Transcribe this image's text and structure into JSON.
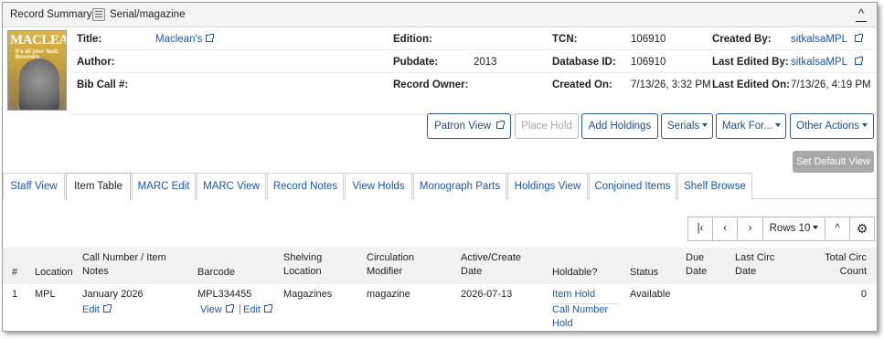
{
  "summary": {
    "title": "Record Summary",
    "format": "Serial/magazine",
    "cover_masthead": "MACLEAN'S",
    "cover_tagline": "It's all your fault, Boomers",
    "fields": {
      "title_label": "Title:",
      "title_value": "Maclean's",
      "author_label": "Author:",
      "author_value": "",
      "bibcall_label": "Bib Call #:",
      "bibcall_value": "",
      "edition_label": "Edition:",
      "edition_value": "",
      "pubdate_label": "Pubdate:",
      "pubdate_value": "2013",
      "owner_label": "Record Owner:",
      "owner_value": "",
      "tcn_label": "TCN:",
      "tcn_value": "106910",
      "dbid_label": "Database ID:",
      "dbid_value": "106910",
      "created_on_label": "Created On:",
      "created_on_value": "7/13/26, 3:32 PM",
      "created_by_label": "Created By:",
      "created_by_value": "sitkalsaMPL",
      "edited_by_label": "Last Edited By:",
      "edited_by_value": "sitkalsaMPL",
      "edited_on_label": "Last Edited On:",
      "edited_on_value": "7/13/26, 4:19 PM"
    }
  },
  "actions": {
    "patron_view": "Patron View",
    "place_hold": "Place Hold",
    "add_holdings": "Add Holdings",
    "serials": "Serials",
    "mark_for": "Mark For...",
    "other_actions": "Other Actions",
    "set_default_view": "Set Default View"
  },
  "tabs": [
    "Staff View",
    "Item Table",
    "MARC Edit",
    "MARC View",
    "Record Notes",
    "View Holds",
    "Monograph Parts",
    "Holdings View",
    "Conjoined Items",
    "Shelf Browse"
  ],
  "active_tab": "Item Table",
  "pager": {
    "first_icon": "first-page-icon",
    "prev_icon": "chevron-left-icon",
    "next_icon": "chevron-right-icon",
    "rows_label": "Rows 10",
    "collapse_icon": "chevron-up-icon",
    "settings_icon": "gear-icon"
  },
  "table": {
    "headers": {
      "num": "#",
      "location": "Location",
      "callnum": "Call Number / Item Notes",
      "barcode": "Barcode",
      "shelving": "Shelving Location",
      "circmod": "Circulation Modifier",
      "active": "Active/Create Date",
      "holdable": "Holdable?",
      "status": "Status",
      "due": "Due Date",
      "lastcirc": "Last Circ Date",
      "totalcirc": "Total Circ Count"
    },
    "rows": [
      {
        "num": "1",
        "location": "MPL",
        "callnum": "January 2026",
        "callnum_edit": "Edit",
        "barcode": "MPL334455",
        "barcode_view": "View",
        "barcode_edit": "Edit",
        "shelving": "Magazines",
        "circmod": "magazine",
        "active": "2026-07-13",
        "item_hold": "Item Hold",
        "callnum_hold": "Call Number Hold",
        "status": "Available",
        "due": "",
        "lastcirc": "",
        "totalcirc": "0"
      }
    ]
  }
}
